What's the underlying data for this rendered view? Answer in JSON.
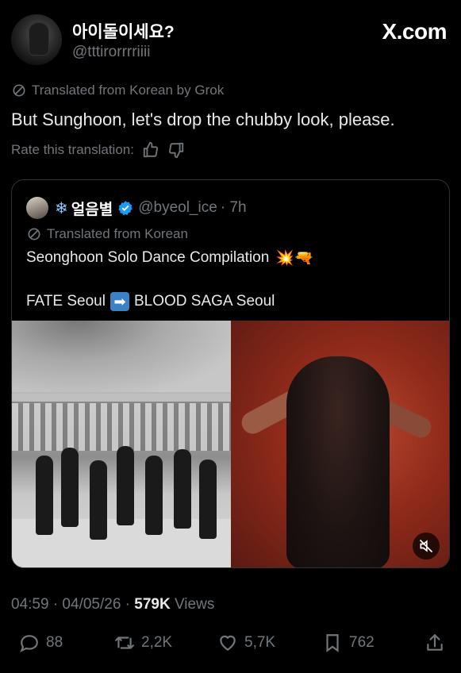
{
  "author": {
    "display_name": "아이돌이세요?",
    "handle": "@tttirorrrriiii"
  },
  "brand": {
    "site": "X.com"
  },
  "translation": {
    "label": "Translated from Korean by Grok",
    "text": "But Sunghoon, let's drop the chubby look, please.",
    "rate_label": "Rate this translation:"
  },
  "quote": {
    "name": "얼음별",
    "handle": "@byeol_ice",
    "time": "· 7h",
    "translated_label": "Translated from Korean",
    "line1": "Seonghoon Solo Dance Compilation",
    "line1_emoji": "💥🔫",
    "line2_a": "FATE Seoul",
    "line2_arrow": "➡",
    "line2_b": "BLOOD SAGA Seoul"
  },
  "meta": {
    "time": "04:59 · 04/05/26 · ",
    "views_count": "579K",
    "views_label": " Views"
  },
  "actions": {
    "replies": "88",
    "reposts": "2,2K",
    "likes": "5,7K",
    "bookmarks": "762"
  },
  "colors": {
    "background": "#000000",
    "text": "#e7e9ea",
    "muted": "#71767b",
    "border": "#2f3336",
    "verified": "#1d9bf0"
  }
}
